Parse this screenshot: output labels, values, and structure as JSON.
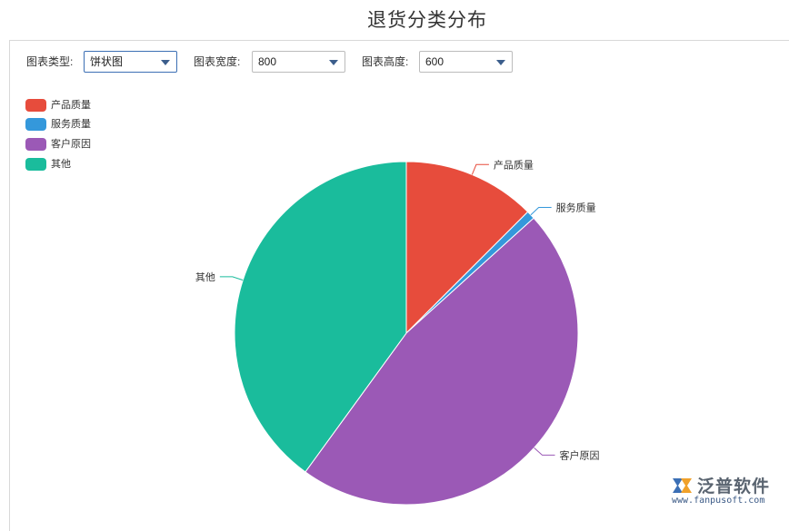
{
  "page": {
    "title": "退货分类分布"
  },
  "controls": {
    "chart_type": {
      "label": "图表类型:",
      "value": "饼状图"
    },
    "chart_width": {
      "label": "图表宽度:",
      "value": "800"
    },
    "chart_height": {
      "label": "图表高度:",
      "value": "600"
    }
  },
  "legend": [
    {
      "label": "产品质量",
      "color": "#e74c3c"
    },
    {
      "label": "服务质量",
      "color": "#3498db"
    },
    {
      "label": "客户原因",
      "color": "#9b59b6"
    },
    {
      "label": "其他",
      "color": "#1abc9c"
    }
  ],
  "chart_data": {
    "type": "pie",
    "title": "",
    "categories": [
      "产品质量",
      "服务质量",
      "客户原因",
      "其他"
    ],
    "values": [
      12.5,
      0.8,
      46.7,
      40.0
    ],
    "colors": [
      "#e74c3c",
      "#3498db",
      "#9b59b6",
      "#1abc9c"
    ],
    "legend_position": "top-left"
  },
  "logo": {
    "icon": "fanpu-logo-icon",
    "name": "泛普软件",
    "url": "www.fanpusoft.com"
  }
}
